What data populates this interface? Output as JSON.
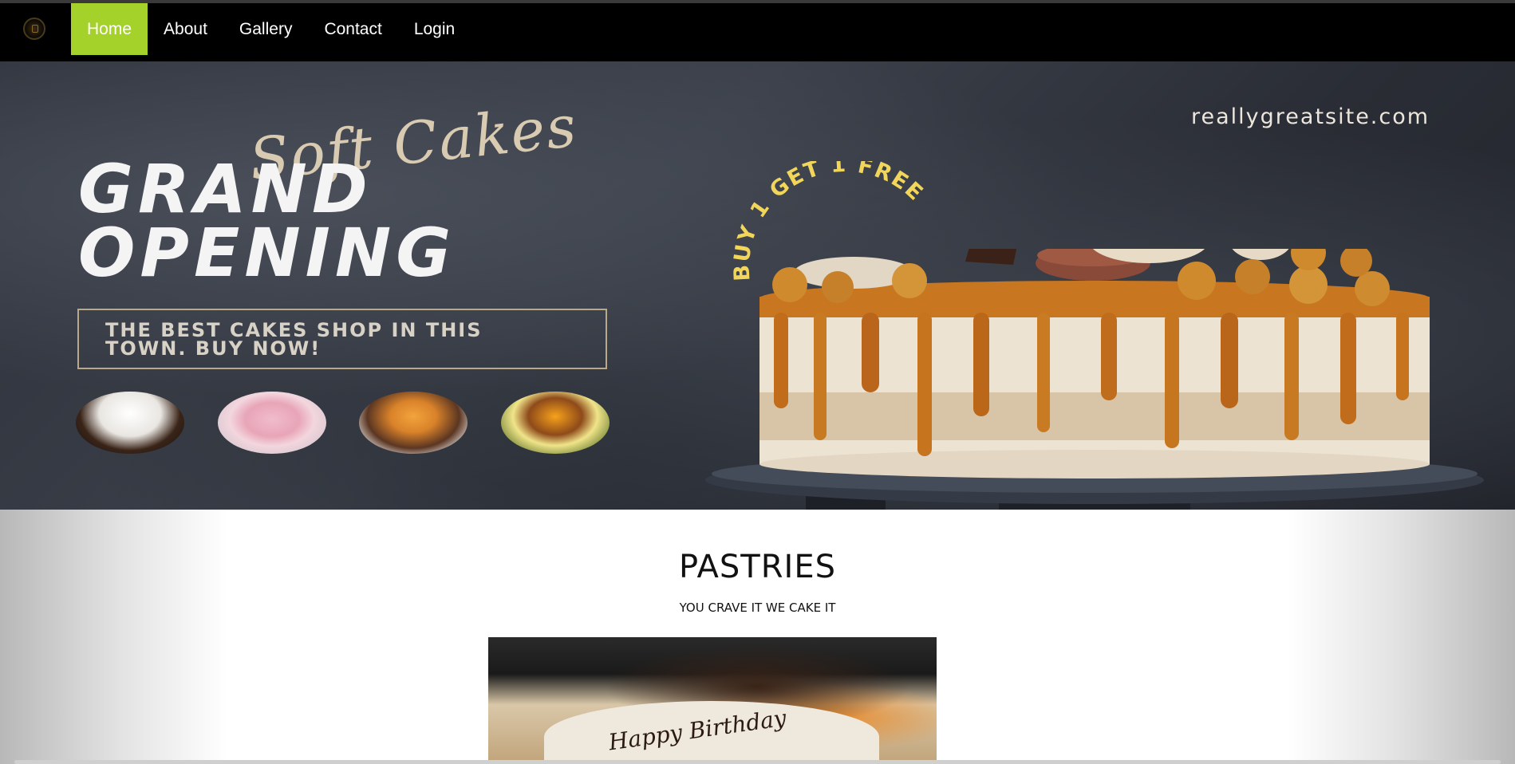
{
  "nav": {
    "logo_icon": "cake-logo-icon",
    "items": [
      {
        "label": "Home",
        "active": true
      },
      {
        "label": "About",
        "active": false
      },
      {
        "label": "Gallery",
        "active": false
      },
      {
        "label": "Contact",
        "active": false
      },
      {
        "label": "Login",
        "active": false
      }
    ]
  },
  "hero": {
    "script_title": "Soft Cakes",
    "headline_line1": "GRAND",
    "headline_line2": "OPENING",
    "tagline_line1": "THE BEST CAKES SHOP IN THIS",
    "tagline_line2": "TOWN. BUY NOW!",
    "website": "reallygreatsite.com",
    "promo": "BUY 1 GET 1 FREE",
    "thumbnails": [
      "white-chocolate-drip-cake",
      "pink-birthday-cake",
      "cupcakes",
      "fruit-cake"
    ]
  },
  "pastries": {
    "title": "PASTRIES",
    "subtitle": "YOU CRAVE IT WE CAKE IT",
    "image_writing": "Happy Birthday"
  },
  "colors": {
    "accent": "#a4d22a",
    "navbar_bg": "#000000",
    "promo_text": "#f2d65a"
  }
}
